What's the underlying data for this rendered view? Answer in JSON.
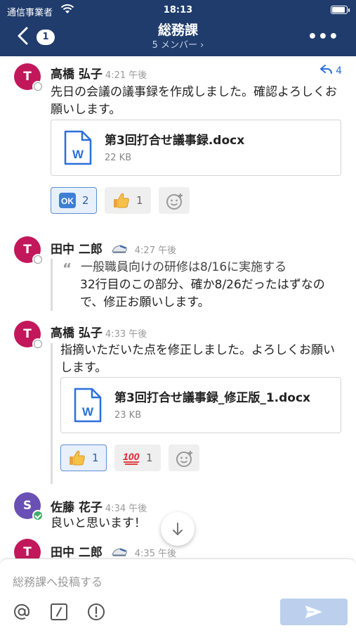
{
  "status_bar": {
    "carrier": "通信事業者",
    "time": "18:13"
  },
  "header": {
    "back_count": "1",
    "title": "総務課",
    "subtitle": "5 メンバー ›"
  },
  "messages": [
    {
      "avatar": "T",
      "author": "高橋 弘子",
      "time": "4:21 午後",
      "reply_count": "4",
      "text": "先日の会議の議事録を作成しました。確認よろしくお願いします。",
      "file": {
        "name": "第3回打合せ議事録.docx",
        "size": "22 KB",
        "icon": "word-file-icon"
      },
      "reactions": [
        {
          "emoji": "ok-button-emoji",
          "count": "2",
          "active": true
        },
        {
          "emoji": "thumbs-up-emoji",
          "count": "1",
          "active": false
        }
      ]
    },
    {
      "avatar": "T",
      "author": "田中 二郎",
      "time": "4:27 午後",
      "quote": "一般職員向けの研修は8/16に実施する",
      "text": "32行目のこの部分、確か8/26だったはずなので、修正お願いします。"
    },
    {
      "avatar": "T",
      "author": "高橋 弘子",
      "time": "4:33 午後",
      "text": "指摘いただいた点を修正しました。よろしくお願いします。",
      "file": {
        "name": "第3回打合せ議事録_修正版_1.docx",
        "size": "23 KB",
        "icon": "word-file-icon"
      },
      "reactions": [
        {
          "emoji": "thumbs-up-emoji",
          "count": "1",
          "active": true
        },
        {
          "emoji": "hundred-points-emoji",
          "count": "1",
          "active": false
        }
      ]
    },
    {
      "avatar": "S",
      "author": "佐藤 花子",
      "time": "4:34 午後",
      "text": "良いと思います！"
    },
    {
      "avatar": "T",
      "author": "田中 二郎",
      "time": "4:35 午後"
    }
  ],
  "composer": {
    "placeholder": "総務課へ投稿する"
  },
  "colors": {
    "header": "#1f3c6c",
    "accent": "#2a6fdb",
    "avatar_t": "#c2185b",
    "avatar_s": "#6a4fb5",
    "send_disabled": "#bcd0ee"
  }
}
